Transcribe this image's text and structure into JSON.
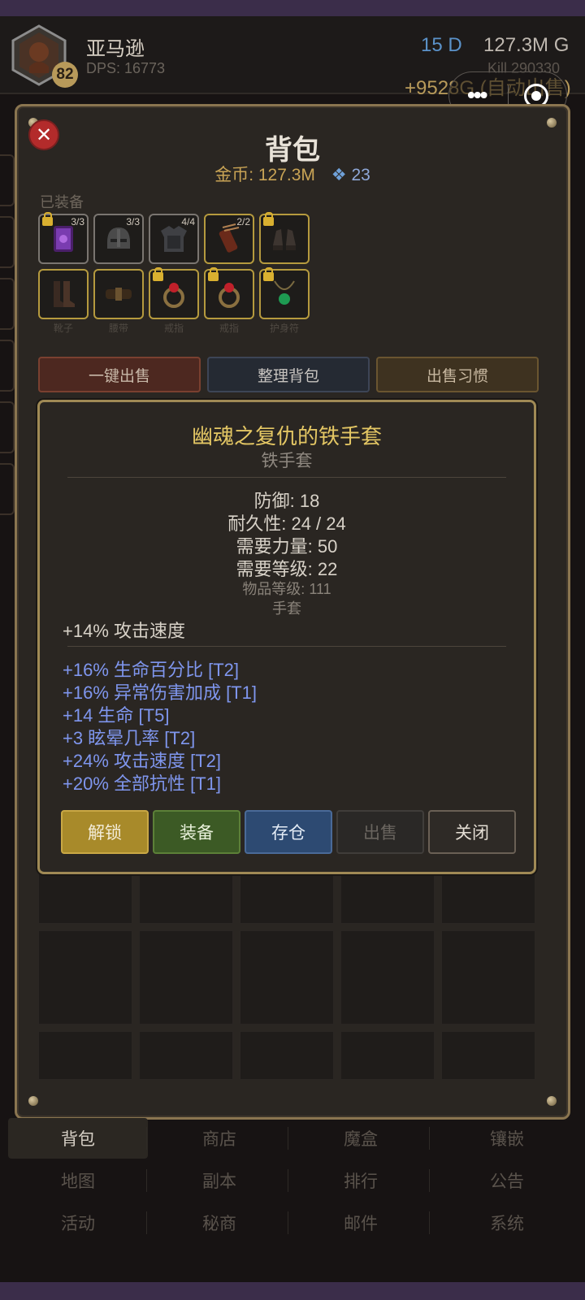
{
  "header": {
    "player_name": "亚马逊",
    "level": "82",
    "dps": "DPS: 16773",
    "diamonds": "15 D",
    "gold": "127.3M G",
    "kill": "Kill 290330",
    "income": "+9528G (自动出售)"
  },
  "panel": {
    "title": "背包",
    "gold_label": "金币: 127.3M",
    "gem_count": "23",
    "equipped_label": "已装备",
    "slots_row1": [
      {
        "icon": "purple-tome-icon",
        "count": "3/3",
        "locked": true,
        "border": "gray"
      },
      {
        "icon": "helmet-icon",
        "count": "3/3",
        "locked": false,
        "border": "gray"
      },
      {
        "icon": "body-armor-icon",
        "count": "4/4",
        "locked": false,
        "border": "gray"
      },
      {
        "icon": "quiver-icon",
        "count": "2/2",
        "locked": false,
        "border": "gold"
      },
      {
        "icon": "gauntlets-icon",
        "count": "",
        "locked": true,
        "border": "gold"
      }
    ],
    "slots_row2": [
      {
        "icon": "boots-icon",
        "label": "靴子",
        "locked": false
      },
      {
        "icon": "belt-icon",
        "label": "腰带",
        "locked": false
      },
      {
        "icon": "ring-icon",
        "label": "戒指",
        "locked": true
      },
      {
        "icon": "ring-icon",
        "label": "戒指",
        "locked": true
      },
      {
        "icon": "amulet-icon",
        "label": "护身符",
        "locked": true
      }
    ],
    "buttons": {
      "sell_all": "一键出售",
      "sort": "整理背包",
      "sell_habit": "出售习惯"
    }
  },
  "tooltip": {
    "name": "幽魂之复仇的铁手套",
    "base": "铁手套",
    "defense": "防御: 18",
    "durability": "耐久性: 24 / 24",
    "req_str": "需要力量: 50",
    "req_level": "需要等级: 22",
    "item_level": "物品等级: 111",
    "slot_type": "手套",
    "implicit": "+14% 攻击速度",
    "affixes": [
      "+16% 生命百分比 [T2]",
      "+16% 异常伤害加成 [T1]",
      "+14 生命 [T5]",
      "+3 眩晕几率 [T2]",
      "+24% 攻击速度 [T2]",
      "+20% 全部抗性 [T1]"
    ],
    "buttons": {
      "unlock": "解锁",
      "equip": "装备",
      "store": "存仓",
      "sell": "出售",
      "close": "关闭"
    }
  },
  "nav": {
    "row1": [
      "背包",
      "商店",
      "魔盒",
      "镶嵌"
    ],
    "row2": [
      "地图",
      "副本",
      "排行",
      "公告"
    ],
    "row3": [
      "活动",
      "秘商",
      "邮件",
      "系统"
    ],
    "active": "背包"
  },
  "colors": {
    "gold_accent": "#c9a455",
    "affix_blue": "#7f96ee",
    "item_name_yellow": "#e4c764",
    "panel_border": "#8a7550"
  }
}
